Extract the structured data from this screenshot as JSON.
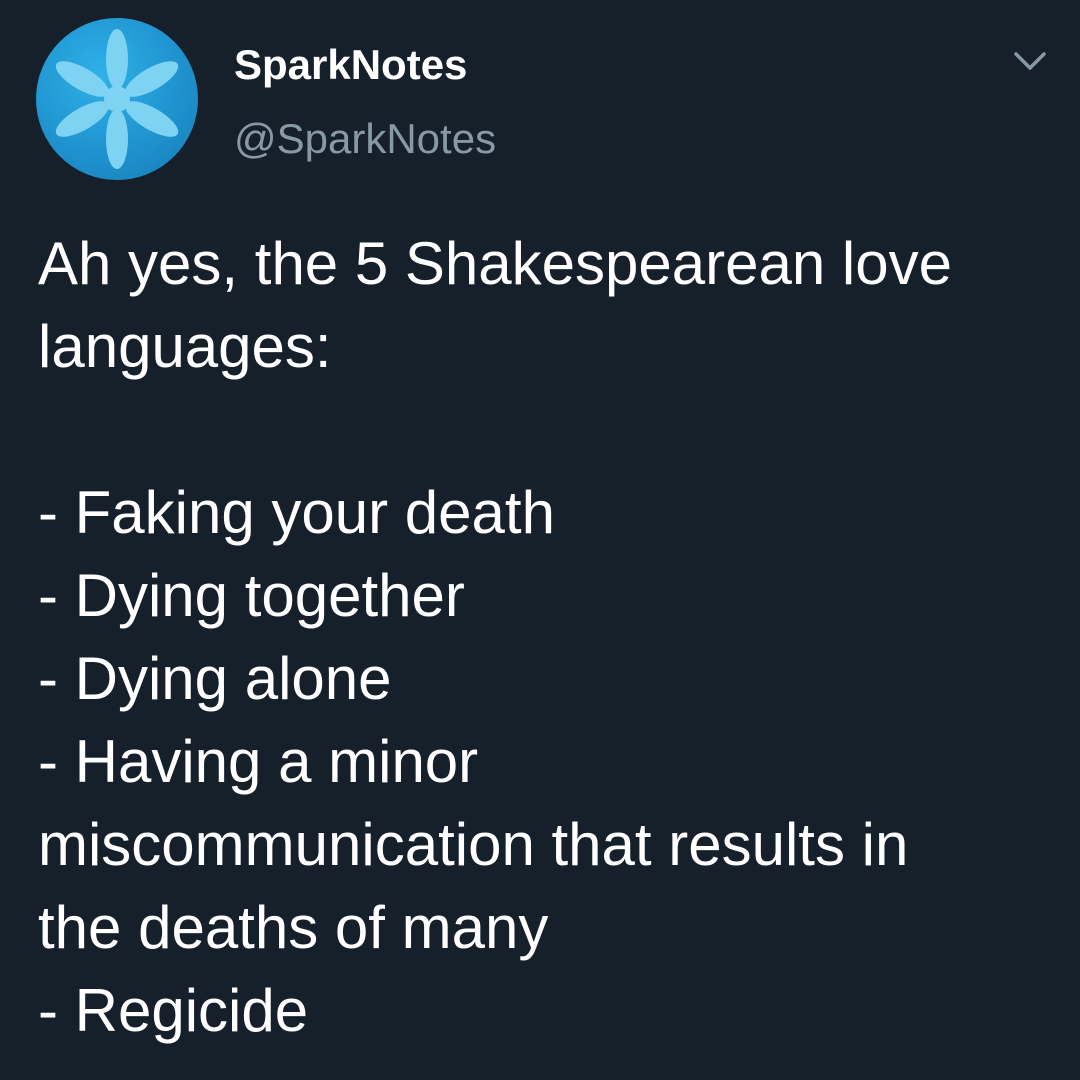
{
  "author": {
    "display_name": "SparkNotes",
    "handle": "@SparkNotes",
    "avatar_icon": "sparknotes-asterisk-logo-icon"
  },
  "menu": {
    "icon": "chevron-down-icon"
  },
  "tweet": {
    "intro_lines": [
      "Ah yes, the 5 Shakespearean love",
      "languages:"
    ],
    "list_lines": [
      "- Faking your death",
      "- Dying together",
      "- Dying alone",
      "- Having a minor",
      "miscommunication that results in",
      "the deaths of many",
      "- Regicide"
    ]
  },
  "colors": {
    "background": "#15202b",
    "text_primary": "#ffffff",
    "text_secondary": "#8899a6",
    "avatar_blue": "#1f93cf",
    "avatar_petals": "#7fd3f2"
  }
}
